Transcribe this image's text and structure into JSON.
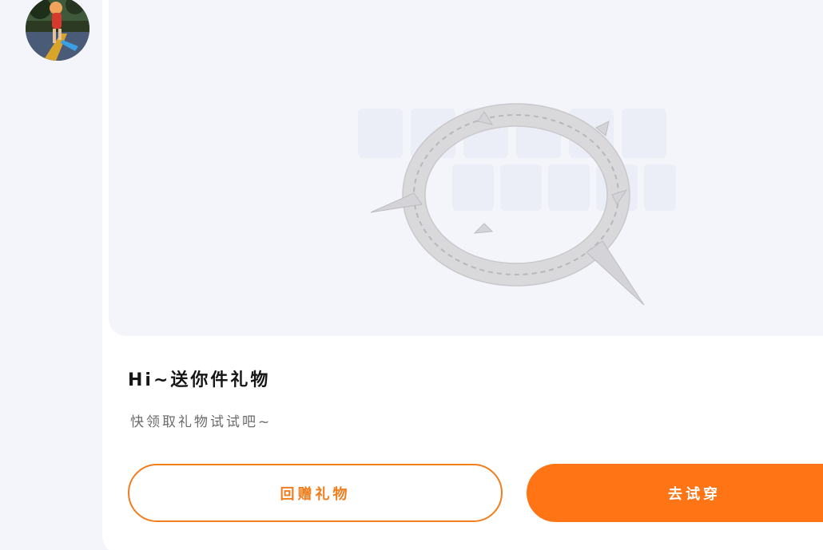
{
  "user": {
    "avatar_icon": "user-avatar-photo"
  },
  "preview": {
    "item_icon": "spiked-ring-accessory",
    "watermark_icon": "avatar-store-watermark"
  },
  "gift": {
    "title": "Hi~送你件礼物",
    "subtitle": "快领取礼物试试吧~"
  },
  "actions": {
    "return_gift_label": "回赠礼物",
    "try_on_label": "去试穿"
  },
  "colors": {
    "accent": "#ff7414",
    "accent_border": "#f07d1e",
    "page_background": "#f4f5fa",
    "card_background": "#ffffff",
    "title_text": "#161616",
    "subtitle_text": "#6b6b6b"
  }
}
